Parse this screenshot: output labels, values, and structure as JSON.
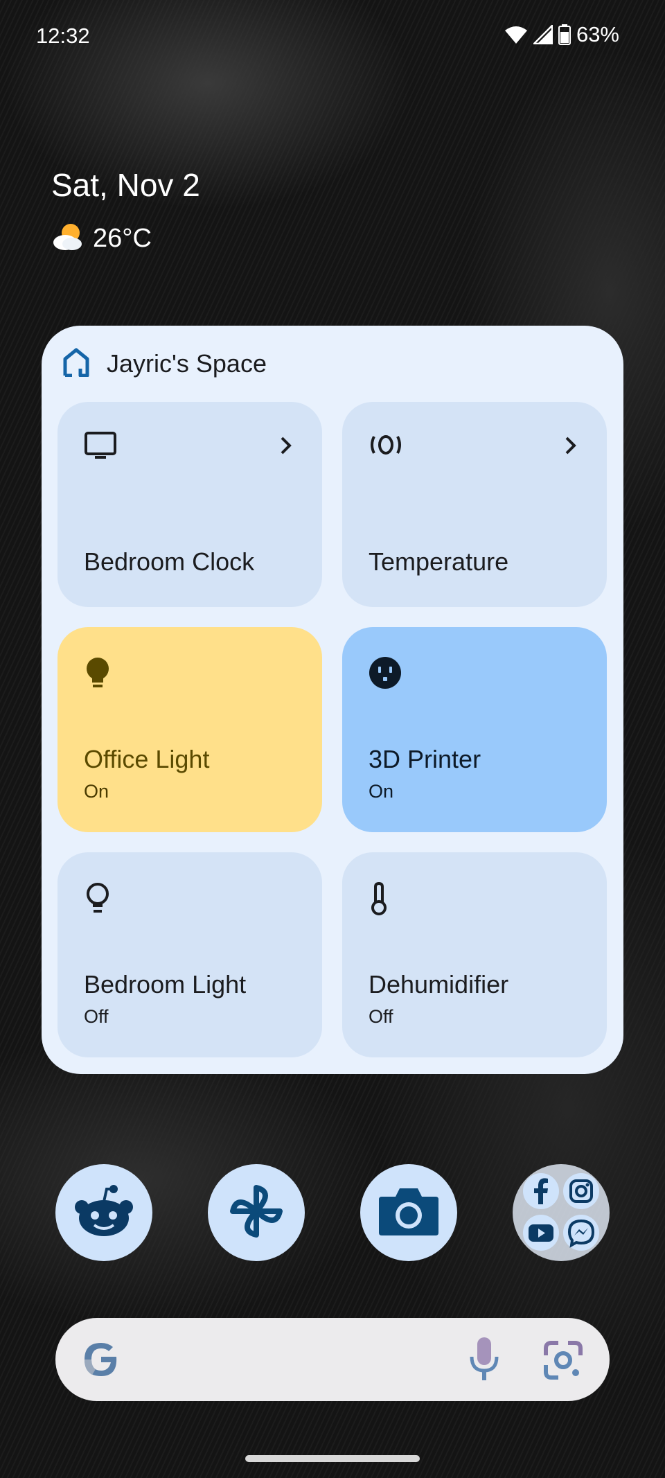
{
  "status_bar": {
    "time": "12:32",
    "battery": "63%"
  },
  "glance": {
    "date": "Sat, Nov 2",
    "temperature": "26°C",
    "weather_icon": "partly-cloudy-icon"
  },
  "widget": {
    "title": "Jayric's Space",
    "tiles": [
      {
        "name": "Bedroom Clock",
        "state": "",
        "icon": "tv-icon",
        "color": "#d4e3f6"
      },
      {
        "name": "Temperature",
        "state": "",
        "icon": "sensor-icon",
        "color": "#d4e3f6"
      },
      {
        "name": "Office Light",
        "state": "On",
        "icon": "lightbulb-icon",
        "color": "#ffe08a"
      },
      {
        "name": "3D Printer",
        "state": "On",
        "icon": "outlet-icon",
        "color": "#99c9fb"
      },
      {
        "name": "Bedroom Light",
        "state": "Off",
        "icon": "lightbulb-outline-icon",
        "color": "#d4e3f6"
      },
      {
        "name": "Dehumidifier",
        "state": "Off",
        "icon": "thermometer-icon",
        "color": "#d4e3f6"
      }
    ]
  },
  "dock": {
    "apps": [
      "reddit-icon",
      "pinwheel-icon",
      "camera-icon"
    ],
    "folder": [
      "facebook-icon",
      "instagram-icon",
      "youtube-icon",
      "messenger-icon"
    ]
  },
  "search_bar": {
    "icons": [
      "google-g-icon",
      "microphone-icon",
      "lens-icon"
    ]
  },
  "colors": {
    "widget_bg": "#e8f1fd",
    "tile_default": "#d4e3f6",
    "tile_light_on": "#ffe08a",
    "tile_plug_on": "#99c9fb",
    "icon_accent": "#0b4a7a"
  }
}
